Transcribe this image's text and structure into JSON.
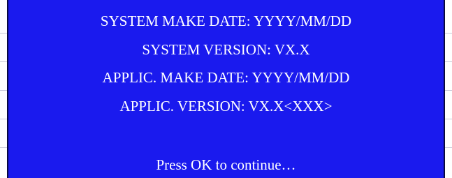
{
  "screen": {
    "background": "#1a1aee",
    "text_color": "#ffffff",
    "lines": [
      "SYSTEM MAKE DATE: YYYY/MM/DD",
      "SYSTEM VERSION: VX.X",
      "APPLIC. MAKE DATE: YYYY/MM/DD",
      "APPLIC. VERSION: VX.X<XXX>"
    ],
    "prompt": "Press OK to continue…"
  }
}
